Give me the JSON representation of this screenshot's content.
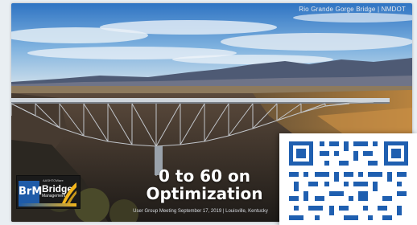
{
  "credit": "Rio Grande Gorge Bridge | NMDOT",
  "title_line1": "0 to 60 on",
  "title_line2": "Optimization",
  "subtitle": "User Group Meeting September 17, 2019 | Louisville, Kentucky",
  "logo": {
    "small_text": "AASHTOWare",
    "abbr": "BrM",
    "bridge": "Bridge",
    "management": "Management"
  },
  "qr_icon": "qr-code-icon"
}
